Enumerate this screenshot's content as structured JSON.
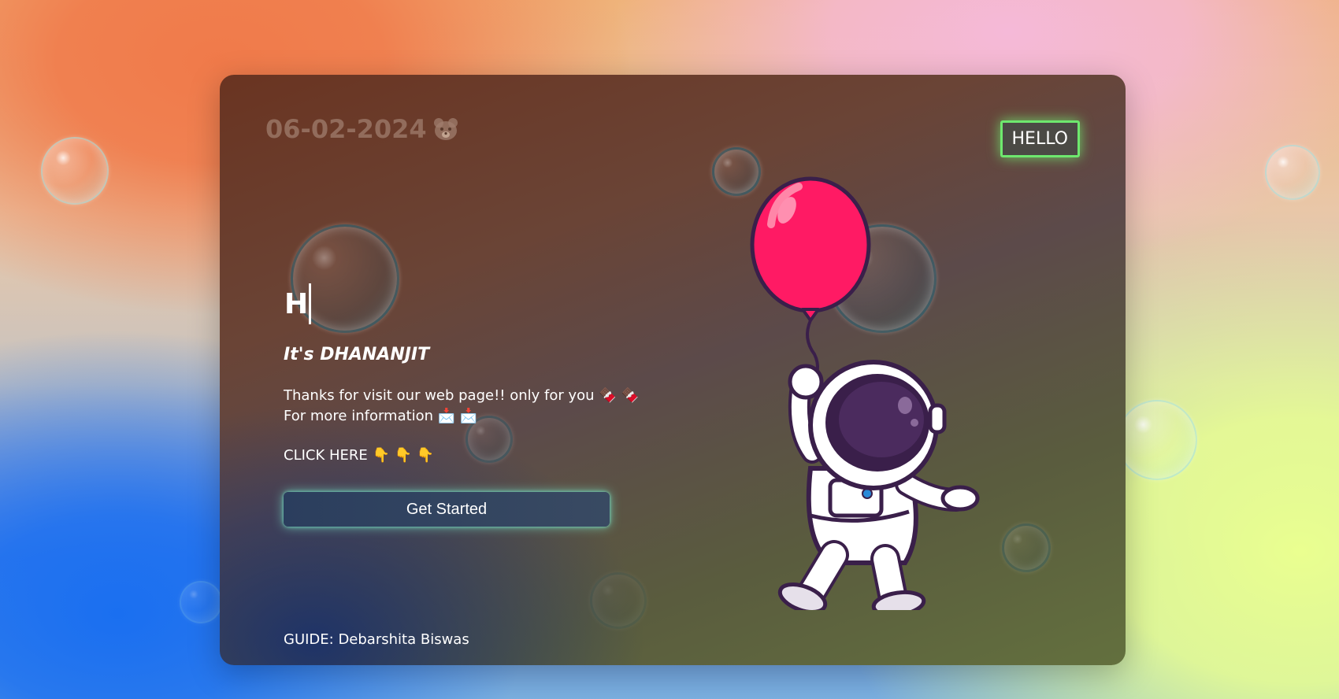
{
  "header": {
    "date": "06-02-2024",
    "hello_button": "HELLO"
  },
  "hero": {
    "typed_text": "H",
    "name": "It's DHANANJIT",
    "line1": "Thanks for visit our web page!! only for you 🍫 🍫",
    "line2": "For more information 📩 📩",
    "click_here": "CLICK HERE 👇 👇 👇",
    "button_label": "Get Started"
  },
  "footer": {
    "guide": "GUIDE: Debarshita Biswas"
  },
  "illustration": {
    "icon": "astronaut-with-balloon",
    "balloon_color": "#ff1a64",
    "helmet_visor_color": "#3a1f4a"
  },
  "colors": {
    "hello_glow": "#6ee86e",
    "button_glow": "#78e6c8"
  }
}
